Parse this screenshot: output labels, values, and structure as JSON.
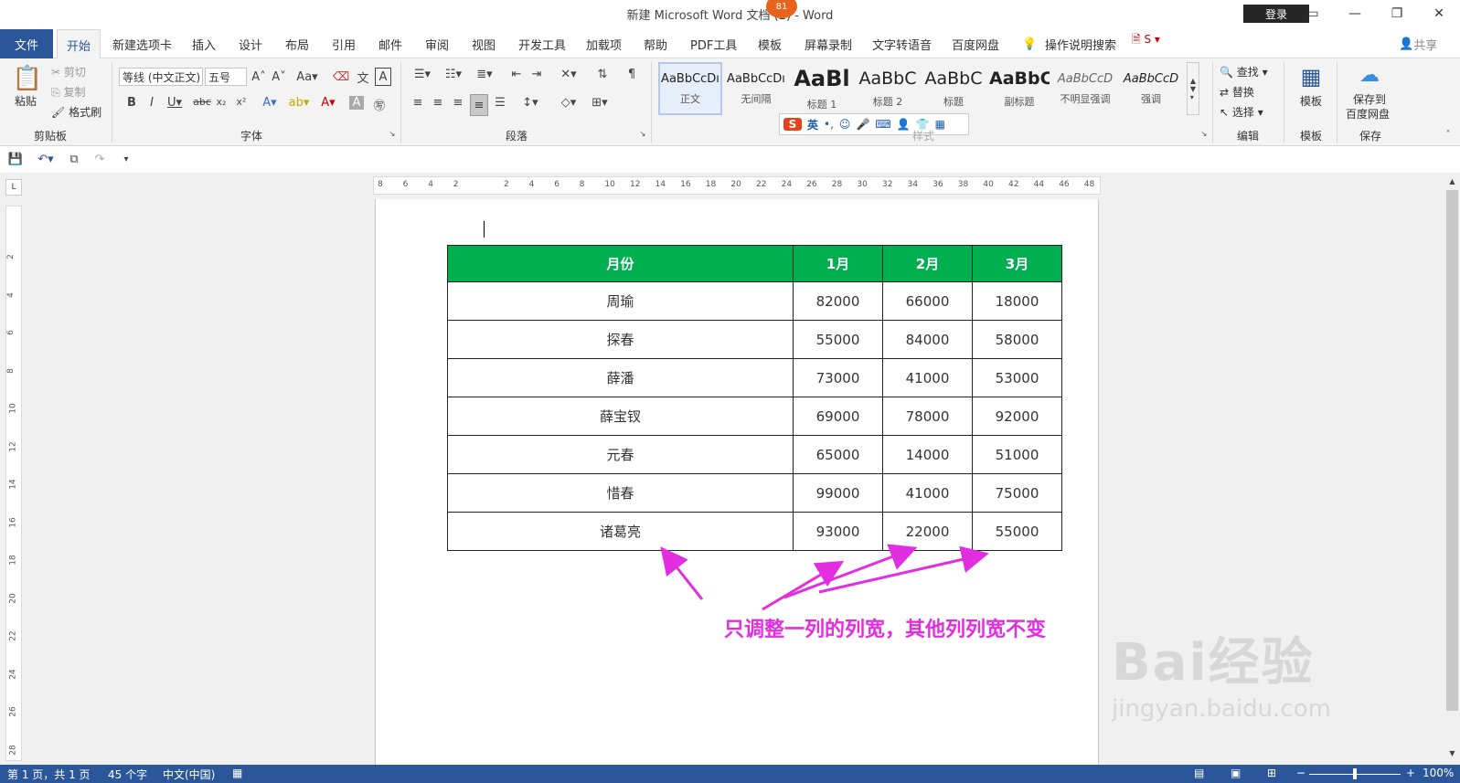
{
  "titlebar": {
    "title": "新建 Microsoft Word 文档 (2) - Word",
    "login": "登录",
    "badge": "81"
  },
  "tabs": {
    "file": "文件",
    "items": [
      "开始",
      "新建选项卡",
      "插入",
      "设计",
      "布局",
      "引用",
      "邮件",
      "审阅",
      "视图",
      "开发工具",
      "加载项",
      "帮助",
      "PDF工具",
      "模板",
      "屏幕录制",
      "文字转语音",
      "百度网盘"
    ],
    "tell_me": "操作说明搜索",
    "share": "共享"
  },
  "ribbon": {
    "clipboard": {
      "paste": "粘贴",
      "cut": "剪切",
      "copy": "复制",
      "format_painter": "格式刷",
      "label": "剪贴板"
    },
    "font": {
      "font_name": "等线 (中文正文)",
      "font_size": "五号",
      "label": "字体"
    },
    "paragraph": {
      "label": "段落"
    },
    "styles": {
      "items": [
        {
          "preview": "AaBbCcDı",
          "name": "正文"
        },
        {
          "preview": "AaBbCcDı",
          "name": "无间隔"
        },
        {
          "preview": "AaBl",
          "name": "标题 1"
        },
        {
          "preview": "AaBbC",
          "name": "标题 2"
        },
        {
          "preview": "AaBbC",
          "name": "标题"
        },
        {
          "preview": "AaBbC",
          "name": "副标题"
        },
        {
          "preview": "AaBbCcD",
          "name": "不明显强调"
        },
        {
          "preview": "AaBbCcD",
          "name": "强调"
        }
      ],
      "label": "样式",
      "ime_label": "英"
    },
    "editing": {
      "find": "查找",
      "replace": "替换",
      "select": "选择",
      "label": "编辑"
    },
    "template": {
      "button": "模板",
      "label": "模板"
    },
    "save": {
      "button_line1": "保存到",
      "button_line2": "百度网盘",
      "label": "保存"
    }
  },
  "ruler": {
    "h_ticks": [
      "8",
      "6",
      "4",
      "2",
      "",
      "2",
      "4",
      "6",
      "8",
      "10",
      "12",
      "14",
      "16",
      "18",
      "20",
      "22",
      "24",
      "26",
      "28",
      "30",
      "32",
      "34",
      "36",
      "38",
      "40",
      "42",
      "44",
      "46",
      "48"
    ],
    "v_ticks": [
      "2",
      "4",
      "6",
      "8",
      "10",
      "12",
      "14",
      "16",
      "18",
      "20",
      "22",
      "24",
      "26",
      "28"
    ]
  },
  "table": {
    "headers": [
      "月份",
      "1月",
      "2月",
      "3月"
    ],
    "rows": [
      [
        "周瑜",
        "82000",
        "66000",
        "18000"
      ],
      [
        "探春",
        "55000",
        "84000",
        "58000"
      ],
      [
        "薛潘",
        "73000",
        "41000",
        "53000"
      ],
      [
        "薛宝钗",
        "69000",
        "78000",
        "92000"
      ],
      [
        "元春",
        "65000",
        "14000",
        "51000"
      ],
      [
        "惜春",
        "99000",
        "41000",
        "75000"
      ],
      [
        "诸葛亮",
        "93000",
        "22000",
        "55000"
      ]
    ]
  },
  "annotation": "只调整一列的列宽，其他列列宽不变",
  "watermark": {
    "brand": "Bai经验",
    "url": "jingyan.baidu.com"
  },
  "status": {
    "page": "第 1 页，共 1 页",
    "words": "45 个字",
    "lang": "中文(中国)",
    "zoom": "100%"
  },
  "colors": {
    "accent": "#2b579a",
    "header_green": "#00b050",
    "annotation": "#e22ee0"
  }
}
